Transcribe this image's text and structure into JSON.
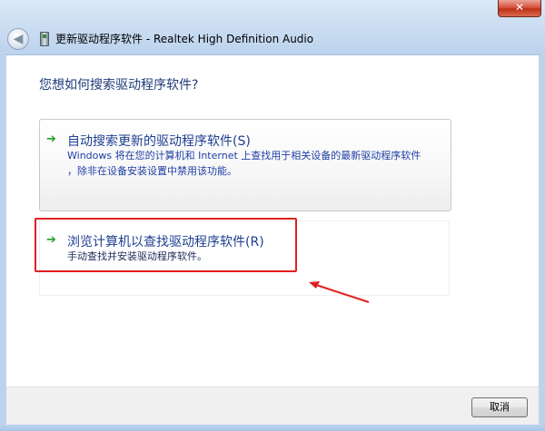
{
  "window": {
    "title": "更新驱动程序软件 - Realtek High Definition Audio",
    "close_glyph": "✕",
    "back_glyph": "◀"
  },
  "question": "您想如何搜索驱动程序软件?",
  "options": [
    {
      "title": "自动搜索更新的驱动程序软件(S)",
      "desc_lines": [
        "Windows 将在您的计算机和 Internet 上查找用于相关设备的最新驱动程序软件",
        "，除非在设备安装设置中禁用该功能。"
      ],
      "icon": "green-arrow-icon"
    },
    {
      "title": "浏览计算机以查找驱动程序软件(R)",
      "desc_lines": [
        "手动查找并安装驱动程序软件。"
      ],
      "icon": "green-arrow-icon"
    }
  ],
  "arrow_glyph": "➔",
  "footer": {
    "cancel_label": "取消"
  },
  "colors": {
    "highlight_box": "#e02020",
    "link_blue": "#1e3e92",
    "arrow_green": "#24a124"
  }
}
